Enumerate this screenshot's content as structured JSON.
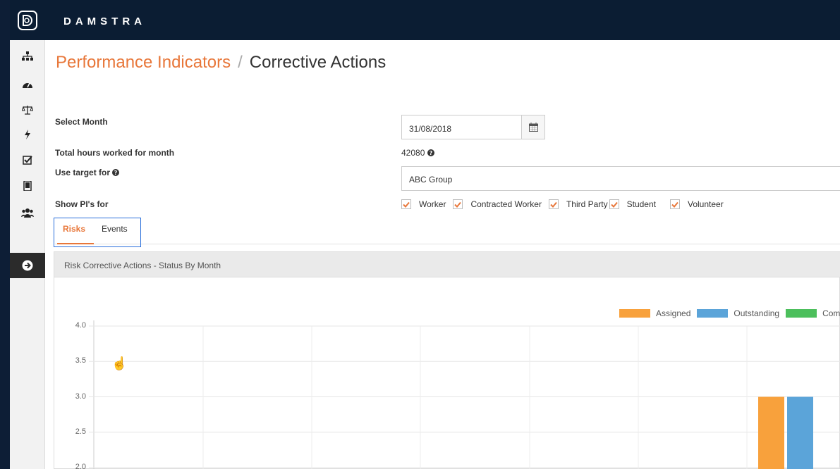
{
  "header": {
    "brand": "DAMSTRA"
  },
  "breadcrumb": {
    "parent": "Performance Indicators",
    "separator": "/",
    "current": "Corrective Actions"
  },
  "nav": {
    "icons": [
      "org-chart-icon",
      "dashboard-icon",
      "scales-icon",
      "lightning-icon",
      "checkbox-icon",
      "tablet-icon",
      "users-icon",
      "arrow-right-circle-icon"
    ]
  },
  "form": {
    "select_month_label": "Select Month",
    "select_month_value": "31/08/2018",
    "total_hours_label": "Total hours worked for month",
    "total_hours_value": "42080",
    "use_target_label": "Use target for",
    "use_target_value": "ABC Group",
    "show_pis_label": "Show PI's for",
    "checkboxes": [
      "Worker",
      "Contracted Worker",
      "Third Party",
      "Student",
      "Volunteer"
    ]
  },
  "tabs": {
    "risks": "Risks",
    "events": "Events"
  },
  "panel": {
    "title": "Risk Corrective Actions - Status By Month"
  },
  "colors": {
    "assigned": "#f8a13c",
    "outstanding": "#5ba4d9",
    "completed": "#4cbf5c",
    "accent": "#e8773a"
  },
  "chart_data": {
    "type": "bar",
    "series": [
      {
        "name": "Assigned",
        "values": [
          0,
          0,
          0,
          0,
          0,
          0,
          3
        ]
      },
      {
        "name": "Outstanding",
        "values": [
          0,
          0,
          0,
          0,
          0,
          0,
          3
        ]
      },
      {
        "name": "Com",
        "values": [
          0,
          0,
          0,
          0,
          0,
          0,
          0
        ]
      }
    ],
    "categories": [
      "",
      "",
      "",
      "",
      "",
      "",
      ""
    ],
    "yticks": [
      "4.0",
      "3.5",
      "3.0",
      "2.5",
      "2.0"
    ],
    "visible_yrange": [
      2.0,
      4.0
    ]
  }
}
